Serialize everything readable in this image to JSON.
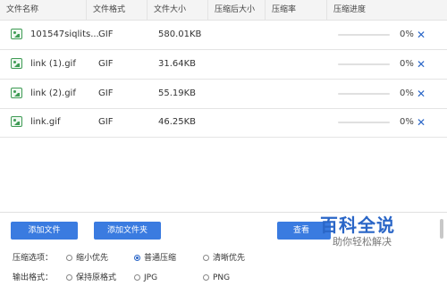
{
  "columns": [
    "文件名称",
    "文件格式",
    "文件大小",
    "压缩后大小",
    "压缩率",
    "压缩进度"
  ],
  "files": [
    {
      "name": "101547siqlits...",
      "format": "GIF",
      "size": "580.01KB",
      "compressed_size": "",
      "ratio": "",
      "progress": 0,
      "progress_text": "0%"
    },
    {
      "name": "link (1).gif",
      "format": "GIF",
      "size": "31.64KB",
      "compressed_size": "",
      "ratio": "",
      "progress": 0,
      "progress_text": "0%"
    },
    {
      "name": "link (2).gif",
      "format": "GIF",
      "size": "55.19KB",
      "compressed_size": "",
      "ratio": "",
      "progress": 0,
      "progress_text": "0%"
    },
    {
      "name": "link.gif",
      "format": "GIF",
      "size": "46.25KB",
      "compressed_size": "",
      "ratio": "",
      "progress": 0,
      "progress_text": "0%"
    }
  ],
  "row_icons": {
    "file": "image-file-icon",
    "remove": "close-icon",
    "remove_glyph": "✕"
  },
  "buttons": {
    "add_file": "添加文件",
    "add_folder": "添加文件夹",
    "view": "查看"
  },
  "compress_options": {
    "label": "压缩选项：",
    "options": [
      "缩小优先",
      "普通压缩",
      "清晰优先"
    ],
    "selected": "普通压缩"
  },
  "output_format": {
    "label": "输出格式：",
    "options": [
      "保持原格式",
      "JPG",
      "PNG"
    ]
  },
  "watermark": {
    "title": "百科全说",
    "subtitle": "助你轻松解决"
  },
  "colors": {
    "accent": "#3a7be0",
    "icon_green": "#3f9b55"
  }
}
